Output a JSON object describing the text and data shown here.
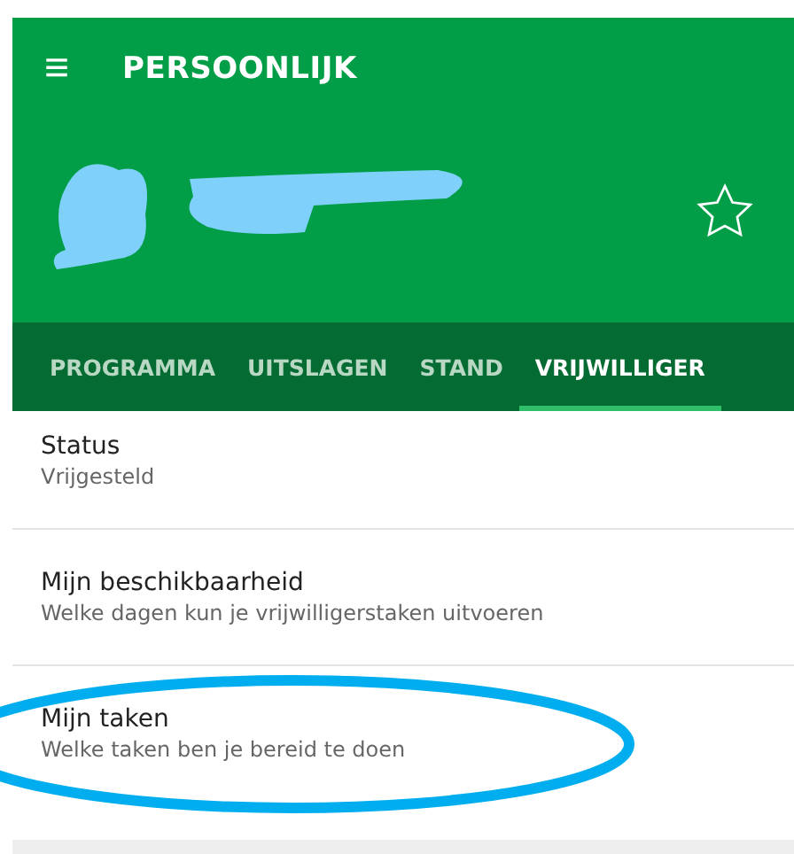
{
  "app_bar": {
    "menu_icon": "≡",
    "title": "PERSOONLIJK"
  },
  "profile": {
    "favorite": false
  },
  "tabs": [
    {
      "label": "PROGRAMMA",
      "selected": false
    },
    {
      "label": "UITSLAGEN",
      "selected": false
    },
    {
      "label": "STAND",
      "selected": false
    },
    {
      "label": "VRIJWILLIGER",
      "selected": true
    }
  ],
  "items": [
    {
      "title": "Status",
      "subtitle": "Vrijgesteld",
      "circled": false
    },
    {
      "title": "Mijn beschikbaarheid",
      "subtitle": "Welke dagen kun je vrijwilligerstaken uitvoeren",
      "circled": false
    },
    {
      "title": "Mijn taken",
      "subtitle": "Welke taken ben je bereid te doen",
      "circled": true
    }
  ]
}
